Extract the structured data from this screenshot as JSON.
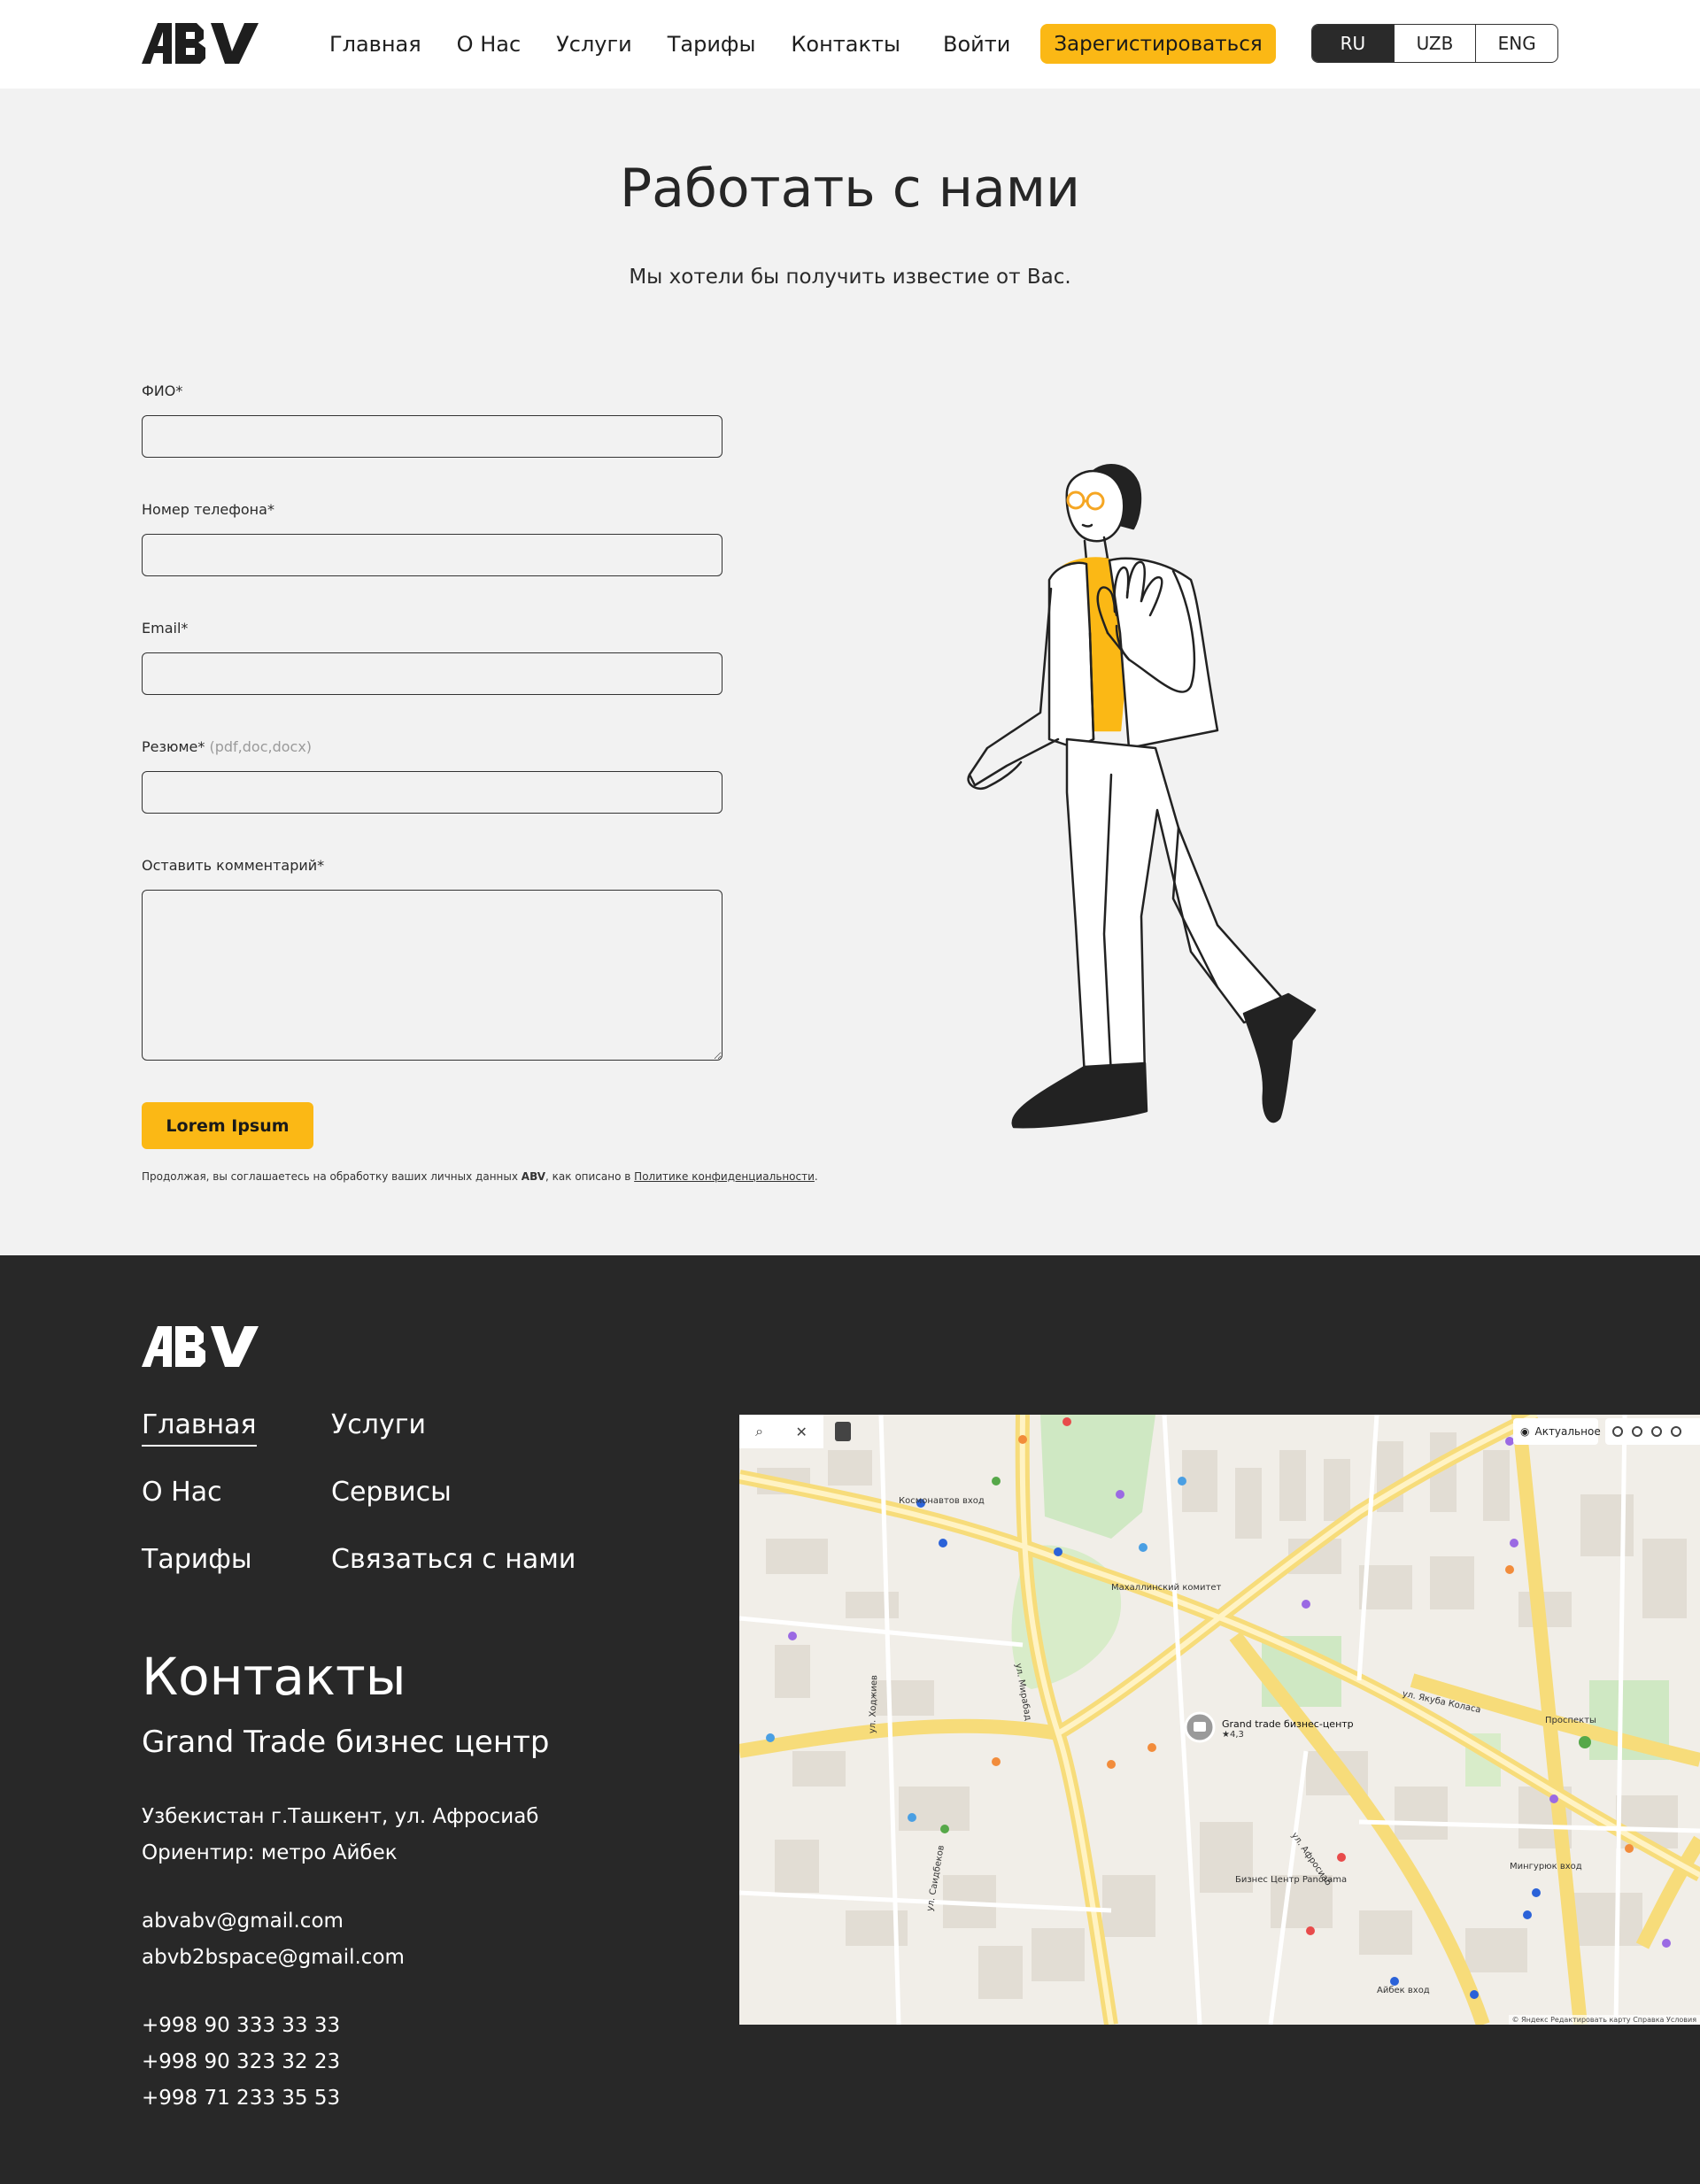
{
  "header": {
    "logo_text": "ABV",
    "nav": [
      "Главная",
      "О Нас",
      "Услуги",
      "Тарифы",
      "Контакты"
    ],
    "login": "Войти",
    "register": "Зарегистироваться",
    "languages": [
      "RU",
      "UZB",
      "ENG"
    ],
    "active_language": "RU"
  },
  "hero": {
    "title": "Работать с нами",
    "subtitle": "Мы хотели бы получить известие от Вас."
  },
  "form": {
    "fio_label": "ФИО*",
    "phone_label": "Номер телефона*",
    "email_label": "Email*",
    "resume_label": "Резюме*",
    "resume_hint": "(pdf,doc,docx)",
    "comment_label": "Оставить комментарий*",
    "submit": "Lorem Ipsum",
    "consent_before": "Продолжая, вы соглашаетесь на обработку ваших личных данных",
    "consent_brand": "ABV",
    "consent_middle": ", как описано в",
    "consent_link": "Политике конфиденциальности",
    "consent_end": "."
  },
  "footer": {
    "logo_text": "ABV",
    "links_col1": [
      "Главная",
      "О Нас",
      "Тарифы"
    ],
    "links_col2": [
      "Услуги",
      "Сервисы",
      "Связаться с нами"
    ],
    "contacts_title": "Контакты",
    "contacts_sub": "Grand Trade бизнес центр",
    "address": "Узбекистан г.Ташкент, ул. Афросиаб",
    "landmark": "Ориентир: метро Айбек",
    "emails": [
      "abvabv@gmail.com",
      "abvb2bspace@gmail.com"
    ],
    "phones": [
      "+998 90 333 33 33",
      "+998 90 323 32 23",
      "+998 71 233 35 53"
    ]
  },
  "map": {
    "layer_label": "Актуальное",
    "marker_name": "Grand trade бизнес-центр",
    "marker_rating": "★4,3",
    "streets": [
      "ул. Мирабад",
      "ул. Афросиаб",
      "ул. Якуба Коласа",
      "ул. Саидбеков",
      "ул. Ходжиев"
    ],
    "places": [
      "Космонавтов вход",
      "Айбек вход",
      "Мингурюк вход",
      "Бизнес Центр Panorama",
      "Махаллинский комитет",
      "Проспекты"
    ],
    "attribution": "© Яндекс  Редактировать карту  Справка  Условия"
  }
}
